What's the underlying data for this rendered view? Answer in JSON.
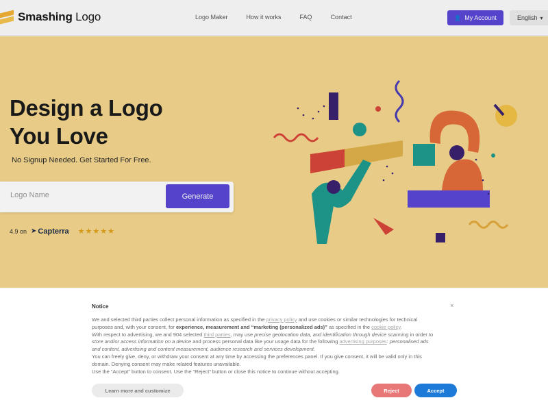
{
  "header": {
    "logo_bold": "Smashing",
    "logo_light": " Logo",
    "nav": [
      "Logo Maker",
      "How it works",
      "FAQ",
      "Contact"
    ],
    "account_label": "My Account",
    "language": "English"
  },
  "hero": {
    "title_line1": "Design a Logo",
    "title_line2": "You Love",
    "subtitle": "No Signup Needed. Get Started For Free.",
    "input_placeholder": "Logo Name",
    "generate_label": "Generate",
    "rating_value": "4.9 on",
    "rating_brand": "Capterra",
    "stars": "★★★★★"
  },
  "notice": {
    "title": "Notice",
    "close": "×",
    "p1_a": "We and selected third parties collect personal information as specified in the ",
    "p1_link1": "privacy policy",
    "p1_b": " and use cookies or similar technologies for technical purposes and, with your consent, for ",
    "p1_bold": "experience, measurement and “marketing (personalized ads)”",
    "p1_c": " as specified in the ",
    "p1_link2": "cookie policy",
    "p1_d": ".",
    "p2_a": "With respect to advertising, we and 904 selected ",
    "p2_link1": "third parties",
    "p2_b": ", may use ",
    "p2_i1": "precise geolocation data, and identification through device scanning",
    "p2_c": " in order to ",
    "p2_i2": "store and/or access information on a device",
    "p2_d": " and process personal data like your usage data for the following ",
    "p2_link2": "advertising purposes",
    "p2_e": ": ",
    "p2_i3": "personalised ads and content, advertising and content measurement, audience research and services development.",
    "p3": "You can freely give, deny, or withdraw your consent at any time by accessing the preferences panel. If you give consent, it will be valid only in this domain. Denying consent may make related features unavailable.",
    "p4": "Use the “Accept” button to consent. Use the “Reject” button or close this notice to continue without accepting.",
    "learn_label": "Learn more and customize",
    "reject_label": "Reject",
    "accept_label": "Accept"
  },
  "colors": {
    "accent": "#5a48d6",
    "hero_bg": "#f4d68e",
    "reject": "#e87777",
    "accept": "#1d7ad9"
  }
}
